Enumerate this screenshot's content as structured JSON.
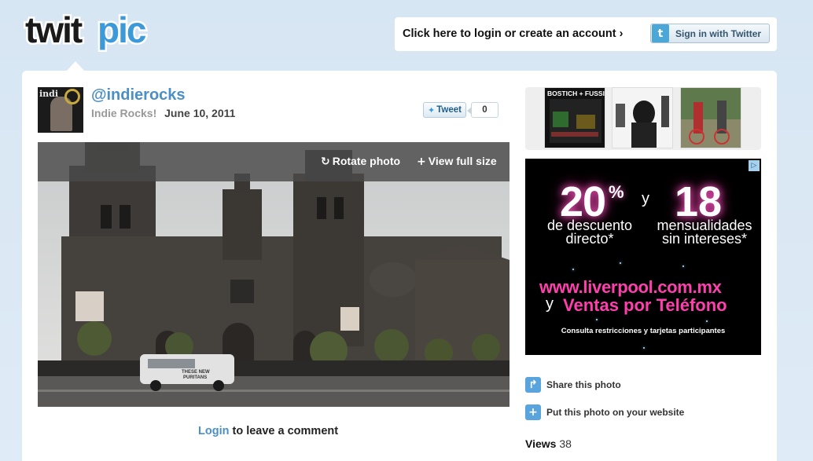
{
  "header": {
    "logo_text_1": "twit",
    "logo_text_2": "pic",
    "login_link": "Click here to login or create an account ›",
    "twitter_button": "Sign in with Twitter"
  },
  "post": {
    "username": "@indierocks",
    "display_name": "Indie Rocks!",
    "date": "June 10, 2011",
    "avatar_text": "indi",
    "tweet_label": "Tweet",
    "tweet_count": "0"
  },
  "photo": {
    "rotate_label": "Rotate photo",
    "fullsize_label": "View full size",
    "van_text_1": "THESE NEW",
    "van_text_2": "PURITANS"
  },
  "comment": {
    "login_label": "Login",
    "rest": " to leave a comment"
  },
  "thumbnails": {
    "thumb1_text": "BOSTICH + FUSSIE"
  },
  "ad": {
    "adchoice": "▷",
    "pct": "20",
    "pct_sym": "%",
    "y": "y",
    "eighteen": "18",
    "desc1": "de descuento directo*",
    "desc2": "mensualidades sin intereses*",
    "url": "www.liverpool.com.mx",
    "y2": "y",
    "ventas": "Ventas por Teléfono",
    "small": "Consulta restricciones y tarjetas participantes"
  },
  "sidebar": {
    "share": "Share this photo",
    "embed": "Put this photo on your website",
    "views_label": "Views",
    "views_count": "38"
  },
  "colors": {
    "link_blue": "#4b8fc7",
    "ad_pink": "#ff3fae",
    "background": "#d7e6f3"
  }
}
